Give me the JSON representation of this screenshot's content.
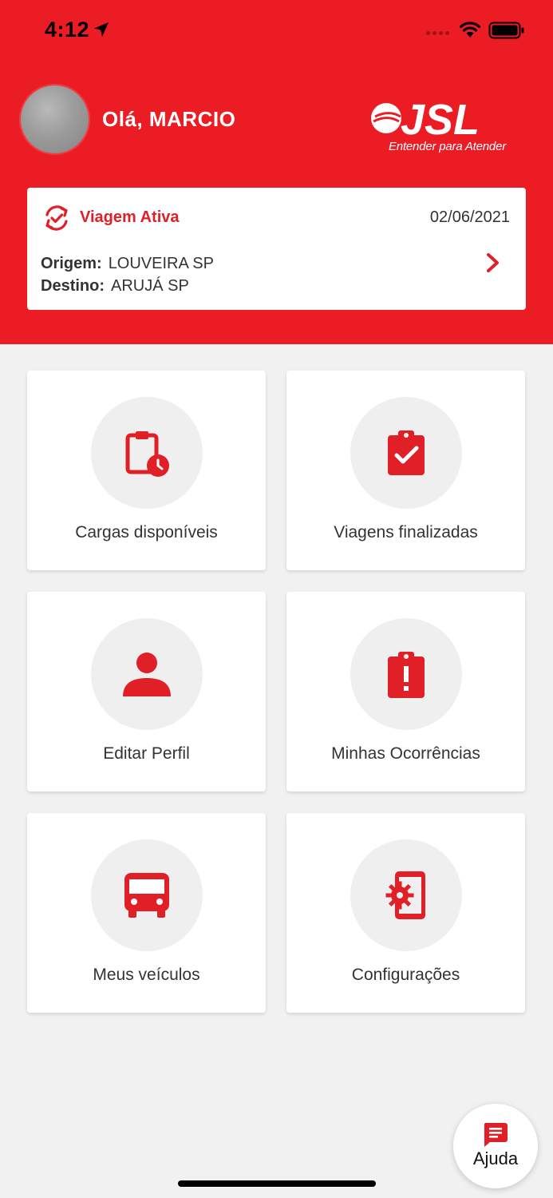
{
  "status_bar": {
    "time": "4:12"
  },
  "header": {
    "greeting": "Olá, MARCIO",
    "logo_text": "JSL",
    "logo_tagline": "Entender para Atender"
  },
  "active_trip": {
    "title": "Viagem Ativa",
    "date": "02/06/2021",
    "origin_label": "Origem:",
    "origin_value": "LOUVEIRA SP",
    "destination_label": "Destino:",
    "destination_value": "ARUJÁ SP"
  },
  "menu": [
    {
      "label": "Cargas disponíveis",
      "icon": "clipboard-clock-icon"
    },
    {
      "label": "Viagens finalizadas",
      "icon": "clipboard-check-icon"
    },
    {
      "label": "Editar Perfil",
      "icon": "person-icon"
    },
    {
      "label": "Minhas Ocorrências",
      "icon": "clipboard-alert-icon"
    },
    {
      "label": "Meus veículos",
      "icon": "bus-icon"
    },
    {
      "label": "Configurações",
      "icon": "phone-settings-icon"
    }
  ],
  "help": {
    "label": "Ajuda",
    "icon": "chat-icon"
  },
  "colors": {
    "brand_red": "#ec1c24",
    "background": "#f1f1f1",
    "icon_circle": "#efefef"
  }
}
